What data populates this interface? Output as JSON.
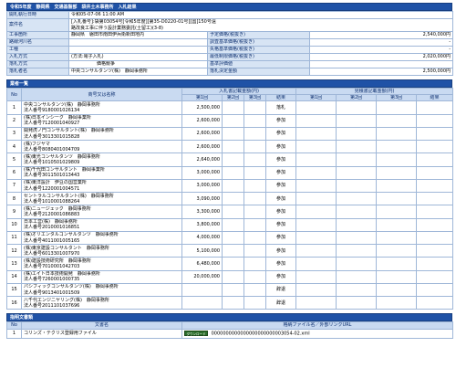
{
  "header": {
    "title": "令和5年度　静岡県　交通基盤部　袋井土木事務所　入札結果"
  },
  "info": {
    "rows": [
      {
        "label": "開札執行日時",
        "value": "令和05-07-06 11:00 AM"
      },
      {
        "label": "案件名",
        "value": "[入札番号]:袋第03054号[令和5年度][第35-D0220-01号][国]150号遠",
        "value2": "路改良工事に伴う設計業務委託(土留工)(3-8)"
      },
      {
        "label": "工事箇所",
        "value": "静岡県　磐田市南田伊兵衛新田地内"
      },
      {
        "label": "路線河川名",
        "value": ""
      },
      {
        "label": "工種",
        "value": ""
      },
      {
        "label": "入札方式",
        "value": "(方法:電子入札)"
      },
      {
        "label": "落札方式",
        "value": "価格競争"
      },
      {
        "label": "落札者名",
        "value": "中央コンサルタンツ(株)　静岡事務所"
      }
    ],
    "right": [
      {
        "label": "予定価格(税抜き)",
        "value": "2,540,000円"
      },
      {
        "label": "調査基準価格(税抜き)",
        "value": "-"
      },
      {
        "label": "失格基準価格(税抜き)",
        "value": "-"
      },
      {
        "label": "最低制限価格(税抜き)",
        "value": "2,020,000円"
      },
      {
        "label": "基準評価値",
        "value": ""
      },
      {
        "label": "落札決定金額",
        "value": "2,500,000円"
      }
    ]
  },
  "bidders": {
    "section_title": "業者一覧",
    "col_no": "No",
    "col_name": "商号又は名称",
    "group_amount": "入札書記載金額(円)",
    "group_bid": "見積書記載金額(円)",
    "col_result": "結果",
    "col_first": "第1回",
    "col_second": "第2回",
    "col_third": "第3回",
    "rows": [
      {
        "no": "1",
        "name": "中央コンサルタンツ(株)　静岡事務所",
        "corp": "法人番号9180001026134",
        "amount": "2,500,000",
        "result": "落札"
      },
      {
        "no": "2",
        "name": "(株)日本インシーク　静岡事業所",
        "corp": "法人番号7120001040927",
        "amount": "2,600,000",
        "result": "参加"
      },
      {
        "no": "3",
        "name": "開発虎ノ門コンサルタント(株)　静岡事務所",
        "corp": "法人番号3013301015828",
        "amount": "2,600,000",
        "result": "参加"
      },
      {
        "no": "4",
        "name": "(株)フジヤマ",
        "corp": "法人番号8080401004709",
        "amount": "2,600,000",
        "result": "参加"
      },
      {
        "no": "5",
        "name": "(株)東光コンサルタンツ　静岡事務所",
        "corp": "法人番号1010501029809",
        "amount": "2,640,000",
        "result": "参加"
      },
      {
        "no": "6",
        "name": "(株)千代田コンサルタント　静岡事業所",
        "corp": "法人番号3011501013443",
        "amount": "3,000,000",
        "result": "参加"
      },
      {
        "no": "7",
        "name": "(株)東洋設計　伊豆の国営業所",
        "corp": "法人番号1220001004571",
        "amount": "3,000,000",
        "result": "参加"
      },
      {
        "no": "8",
        "name": "セントラルコンサルタント(株)　静岡事務所",
        "corp": "法人番号1010001088264",
        "amount": "3,090,000",
        "result": "参加"
      },
      {
        "no": "9",
        "name": "(株)ニュージェック　静岡事務所",
        "corp": "法人番号2120001086883",
        "amount": "3,300,000",
        "result": "参加"
      },
      {
        "no": "10",
        "name": "日本工営(株)　静岡事務所",
        "corp": "法人番号2010001016851",
        "amount": "3,800,000",
        "result": "参加"
      },
      {
        "no": "11",
        "name": "(株)オリエンタルコンサルタンツ　静岡事務所",
        "corp": "法人番号4011001005165",
        "amount": "4,000,000",
        "result": "参加"
      },
      {
        "no": "12",
        "name": "(株)東京建設コンサルタント　静岡事務所",
        "corp": "法人番号6013301007970",
        "amount": "5,100,000",
        "result": "参加"
      },
      {
        "no": "13",
        "name": "(株)建設技術研究所　静岡事務所",
        "corp": "法人番号7010001042703",
        "amount": "6,480,000",
        "result": "参加"
      },
      {
        "no": "14",
        "name": "(株)エイト日本技術開発　静岡事務所",
        "corp": "法人番号7260001000735",
        "amount": "20,000,000",
        "result": "参加"
      },
      {
        "no": "15",
        "name": "パシフィックコンサルタンツ(株)　静岡事務所",
        "corp": "法人番号9013401001509",
        "amount": "",
        "result": "辞退"
      },
      {
        "no": "16",
        "name": "八千代エンジニヤリング(株)　静岡事務所",
        "corp": "法人番号2011101037696",
        "amount": "",
        "result": "辞退"
      }
    ]
  },
  "docs": {
    "section_title": "指明文書類",
    "col_no": "No",
    "col_name": "文書名",
    "col_file": "格納ファイル名／外部リンクURL",
    "rows": [
      {
        "no": "1",
        "name": "コリンズ・テクリス登録用ファイル",
        "button": "ダウンロード",
        "file": "0000000000000000000000003054-02.xml"
      }
    ]
  }
}
